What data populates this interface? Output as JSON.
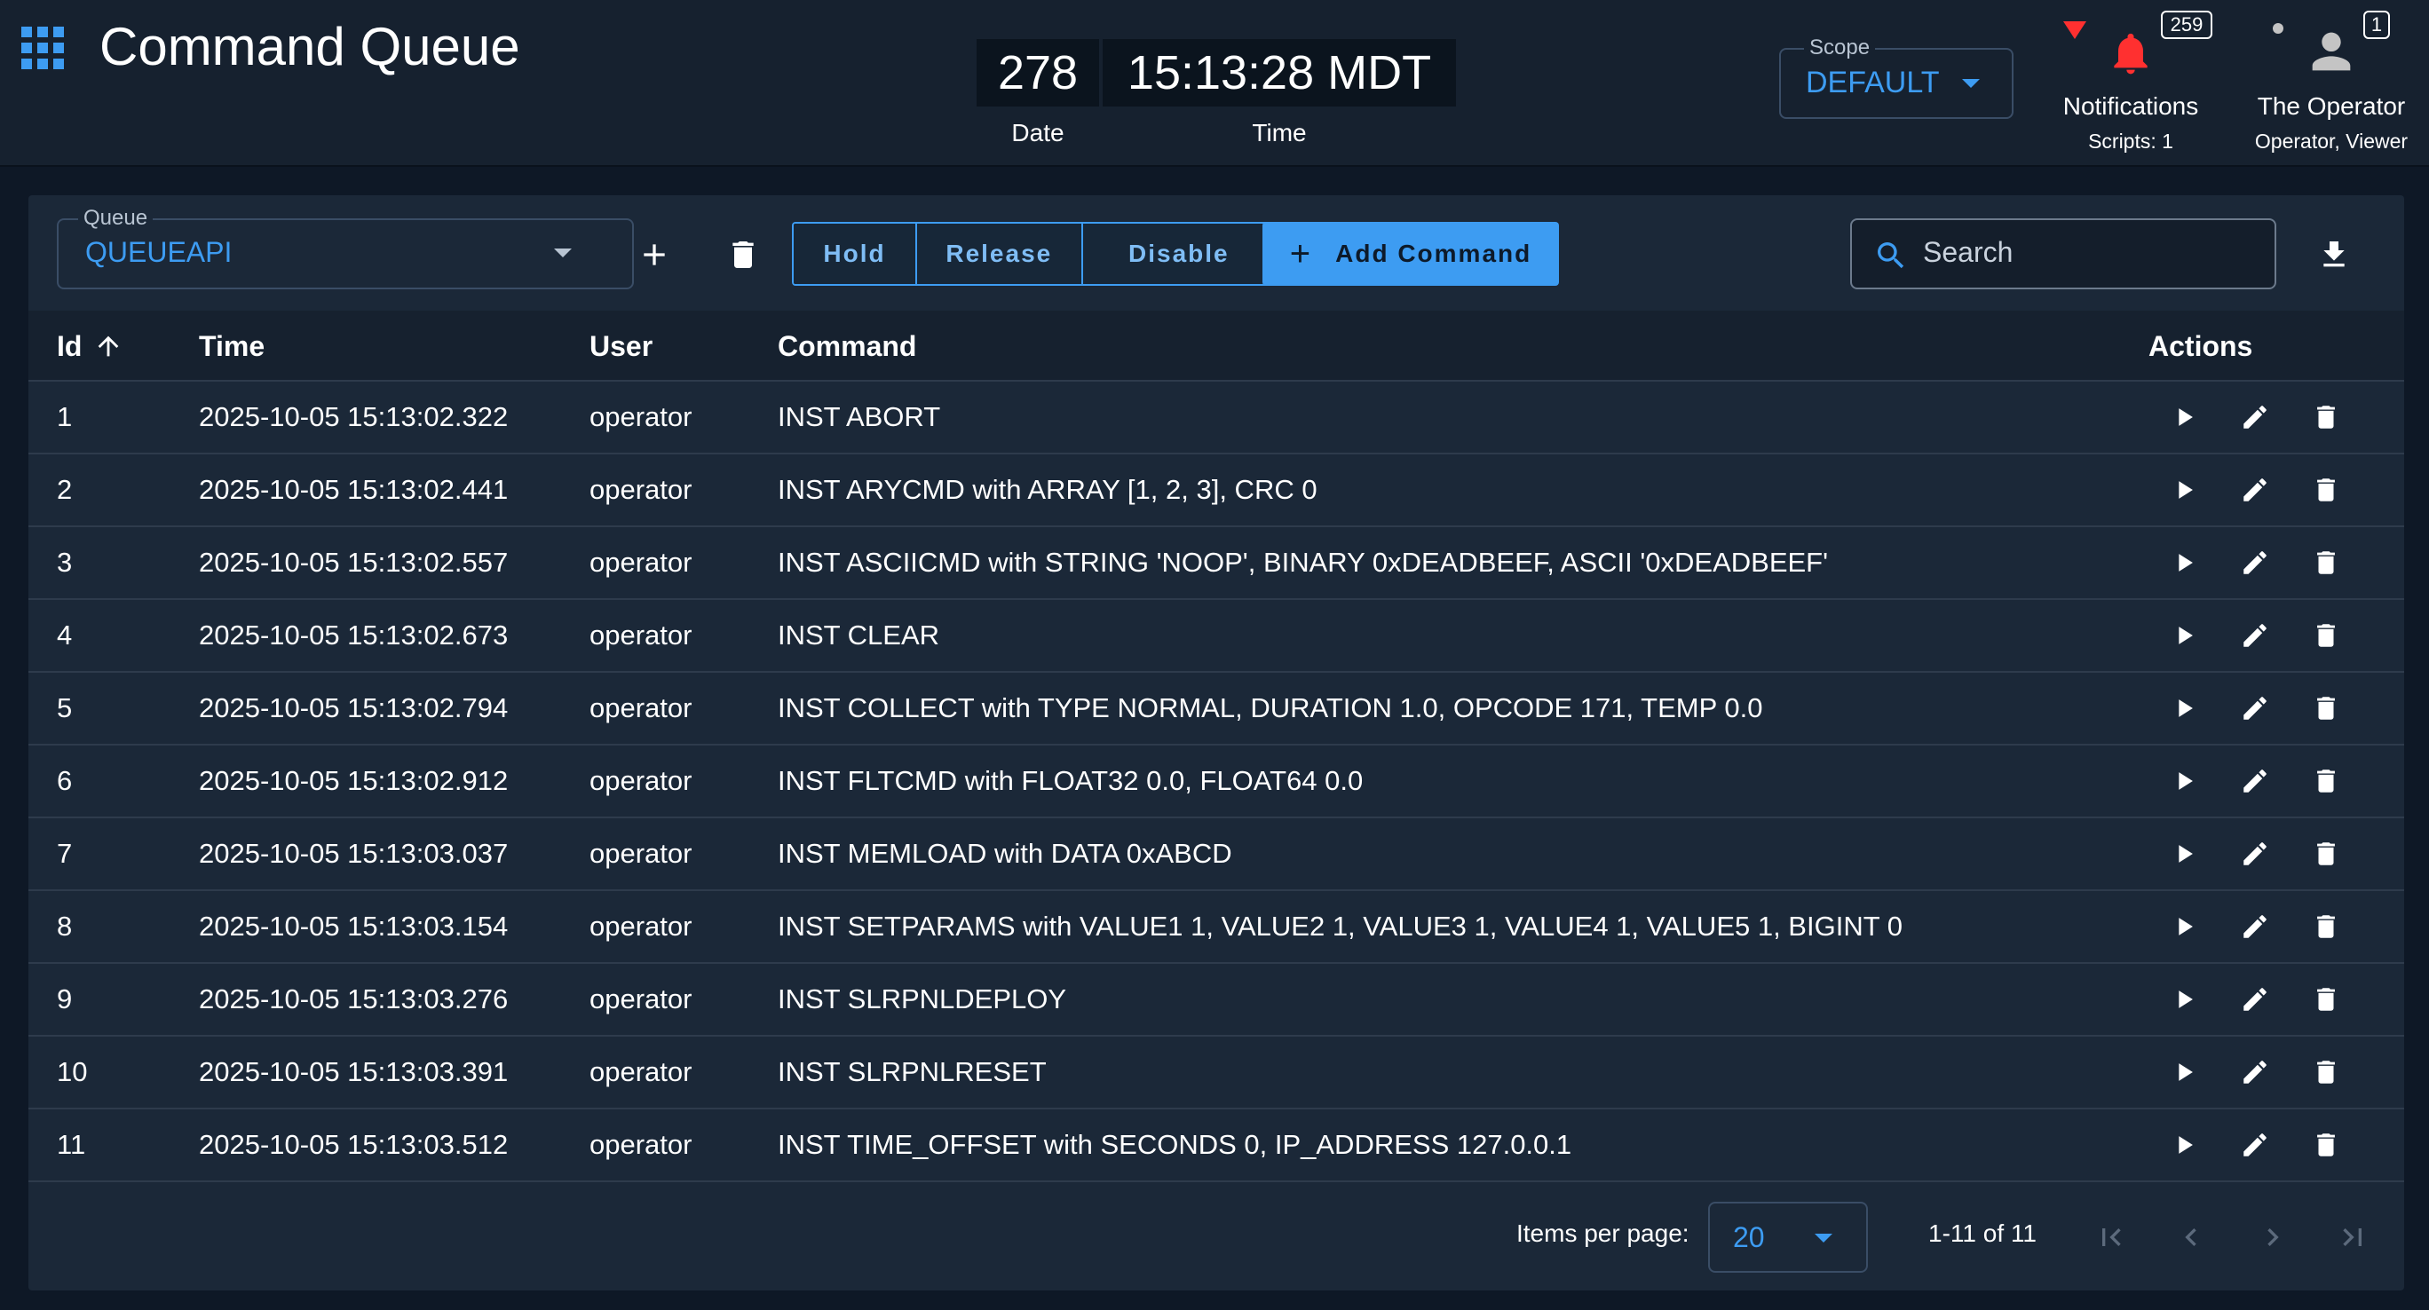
{
  "app": {
    "title": "Command Queue"
  },
  "clock": {
    "date_value": "278",
    "date_label": "Date",
    "time_value": "15:13:28 MDT",
    "time_label": "Time"
  },
  "scope": {
    "legend": "Scope",
    "value": "DEFAULT"
  },
  "notifications": {
    "label": "Notifications",
    "sub": "Scripts: 1",
    "badge": "259"
  },
  "user": {
    "name": "The Operator",
    "roles": "Operator, Viewer",
    "badge": "1"
  },
  "queue": {
    "legend": "Queue",
    "value": "QUEUEAPI"
  },
  "toolbar": {
    "hold": "Hold",
    "release": "Release",
    "disable": "Disable",
    "add_command": "Add Command",
    "search_placeholder": "Search"
  },
  "table": {
    "headers": {
      "id": "Id",
      "time": "Time",
      "user": "User",
      "command": "Command",
      "actions": "Actions"
    },
    "rows": [
      {
        "id": "1",
        "time": "2025-10-05 15:13:02.322",
        "user": "operator",
        "command": "INST ABORT"
      },
      {
        "id": "2",
        "time": "2025-10-05 15:13:02.441",
        "user": "operator",
        "command": "INST ARYCMD with ARRAY [1, 2, 3], CRC 0"
      },
      {
        "id": "3",
        "time": "2025-10-05 15:13:02.557",
        "user": "operator",
        "command": "INST ASCIICMD with STRING 'NOOP', BINARY 0xDEADBEEF, ASCII '0xDEADBEEF'"
      },
      {
        "id": "4",
        "time": "2025-10-05 15:13:02.673",
        "user": "operator",
        "command": "INST CLEAR"
      },
      {
        "id": "5",
        "time": "2025-10-05 15:13:02.794",
        "user": "operator",
        "command": "INST COLLECT with TYPE NORMAL, DURATION 1.0, OPCODE 171, TEMP 0.0"
      },
      {
        "id": "6",
        "time": "2025-10-05 15:13:02.912",
        "user": "operator",
        "command": "INST FLTCMD with FLOAT32 0.0, FLOAT64 0.0"
      },
      {
        "id": "7",
        "time": "2025-10-05 15:13:03.037",
        "user": "operator",
        "command": "INST MEMLOAD with DATA 0xABCD"
      },
      {
        "id": "8",
        "time": "2025-10-05 15:13:03.154",
        "user": "operator",
        "command": "INST SETPARAMS with VALUE1 1, VALUE2 1, VALUE3 1, VALUE4 1, VALUE5 1, BIGINT 0"
      },
      {
        "id": "9",
        "time": "2025-10-05 15:13:03.276",
        "user": "operator",
        "command": "INST SLRPNLDEPLOY"
      },
      {
        "id": "10",
        "time": "2025-10-05 15:13:03.391",
        "user": "operator",
        "command": "INST SLRPNLRESET"
      },
      {
        "id": "11",
        "time": "2025-10-05 15:13:03.512",
        "user": "operator",
        "command": "INST TIME_OFFSET with SECONDS 0, IP_ADDRESS 127.0.0.1"
      }
    ]
  },
  "pagination": {
    "items_per_page_label": "Items per page:",
    "items_per_page": "20",
    "range": "1-11 of 11"
  },
  "colors": {
    "accent": "#3d9cf2",
    "alert": "#ff3030",
    "background": "#0e1826",
    "card": "#1b2838"
  }
}
